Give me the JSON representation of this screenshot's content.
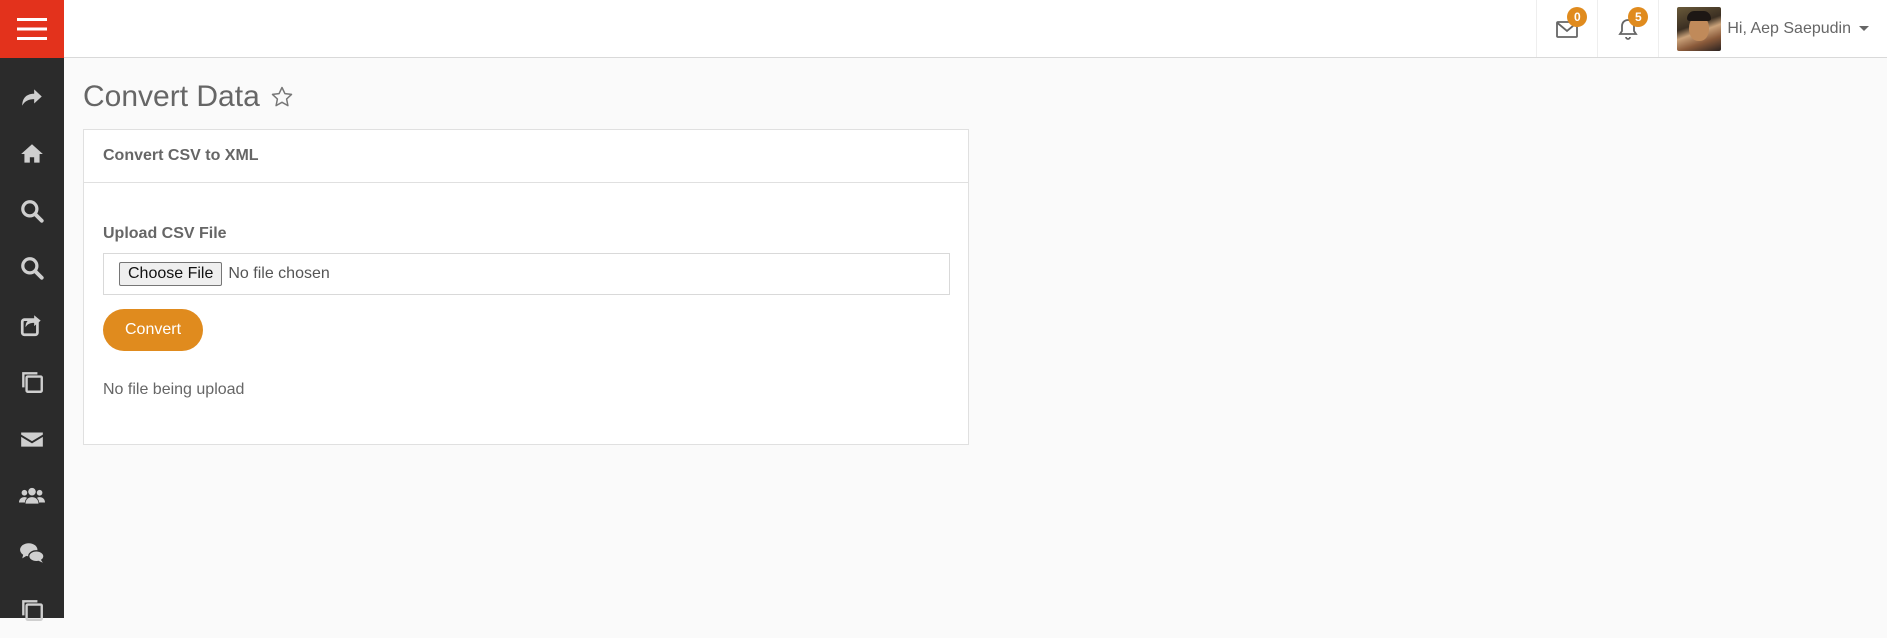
{
  "topbar": {
    "messages_count": "0",
    "notifications_count": "5",
    "user_greeting": "Hi, Aep Saepudin"
  },
  "sidebar": {
    "icons": [
      "share-icon",
      "home-icon",
      "search-icon",
      "search-icon",
      "external-share-icon",
      "copy-icon",
      "mail-icon",
      "users-icon",
      "chat-icon",
      "copy-icon"
    ]
  },
  "page": {
    "title": "Convert Data"
  },
  "panel": {
    "heading": "Convert CSV to XML",
    "upload_label": "Upload CSV File",
    "choose_file_label": "Choose File",
    "file_status": "No file chosen",
    "convert_label": "Convert",
    "upload_status": "No file being upload"
  },
  "colors": {
    "accent": "#e08b1e",
    "brand_red": "#e3321c",
    "sidebar_bg": "#2b2b2b"
  }
}
